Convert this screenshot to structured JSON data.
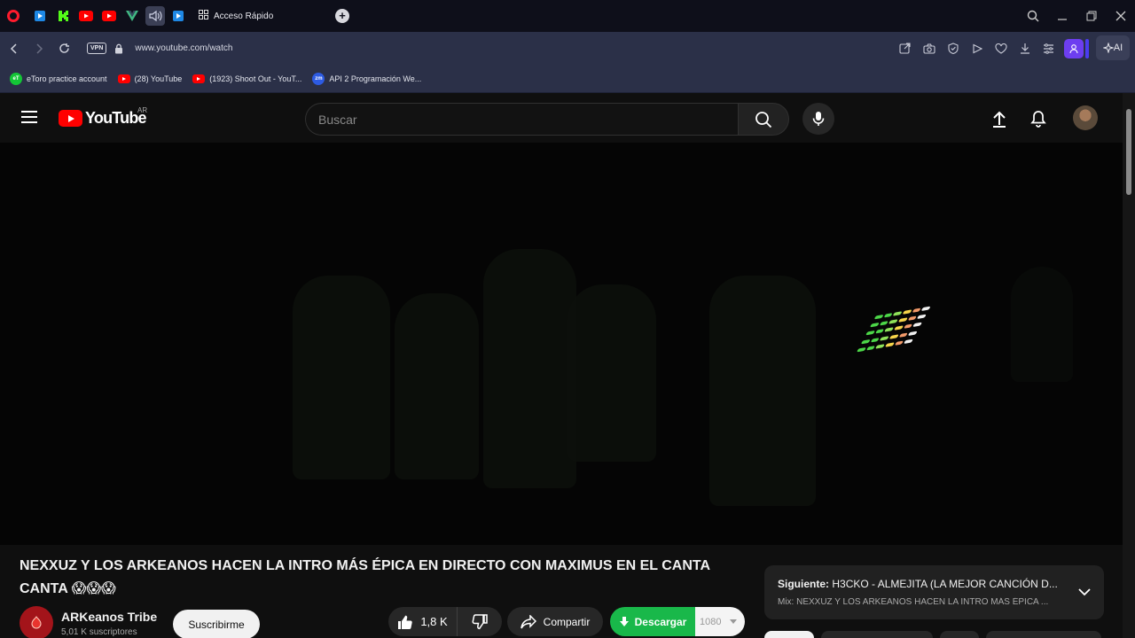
{
  "browser": {
    "tab_title": "Acceso Rápido",
    "url": "www.youtube.com/watch",
    "vpn_label": "VPN",
    "ai_label": "AI",
    "pinned_tabs": [
      {
        "icon": "video-player-icon",
        "color": "#1e88e5"
      },
      {
        "icon": "kick-icon",
        "color": "#53fc18"
      },
      {
        "icon": "youtube-icon",
        "color": "#ff0000"
      },
      {
        "icon": "youtube-icon",
        "color": "#ff0000"
      },
      {
        "icon": "vue-icon",
        "color": "#41b883"
      },
      {
        "icon": "audio-tab-icon",
        "color": "#9ab"
      },
      {
        "icon": "video-player-icon",
        "color": "#1e88e5"
      }
    ]
  },
  "bookmarks": [
    {
      "label": "eToro practice account",
      "icon": "etoro-icon"
    },
    {
      "label": "(28) YouTube",
      "icon": "youtube-icon"
    },
    {
      "label": "(1923) Shoot Out - YouT...",
      "icon": "youtube-icon"
    },
    {
      "label": "API 2 Programación We...",
      "icon": "zoom-icon"
    }
  ],
  "youtube": {
    "logo_text": "YouTube",
    "country_code": "AR",
    "search_placeholder": "Buscar"
  },
  "video": {
    "title": "NEXXUZ Y LOS ARKEANOS HACEN LA INTRO MÁS ÉPICA EN DIRECTO CON MAXIMUS EN EL CANTA CANTA 😱😱😱",
    "channel_name": "ARKeanos Tribe",
    "subscribers": "5,01 K suscriptores",
    "subscribe_label": "Suscribirme",
    "likes": "1,8 K",
    "share_label": "Compartir",
    "download_label": "Descargar",
    "quality": "1080"
  },
  "up_next": {
    "prefix": "Siguiente:",
    "title": "H3CKO - ALMEJITA (LA MEJOR CANCIÓN D...",
    "mix": "Mix: NEXXUZ Y LOS ARKEANOS HACEN LA INTRO MÁS ÉPICA ..."
  },
  "colors": {
    "opera_red": "#ff1b2d",
    "youtube_red": "#ff0000",
    "download_green": "#19b84a",
    "browser_bar": "#2b3048"
  }
}
